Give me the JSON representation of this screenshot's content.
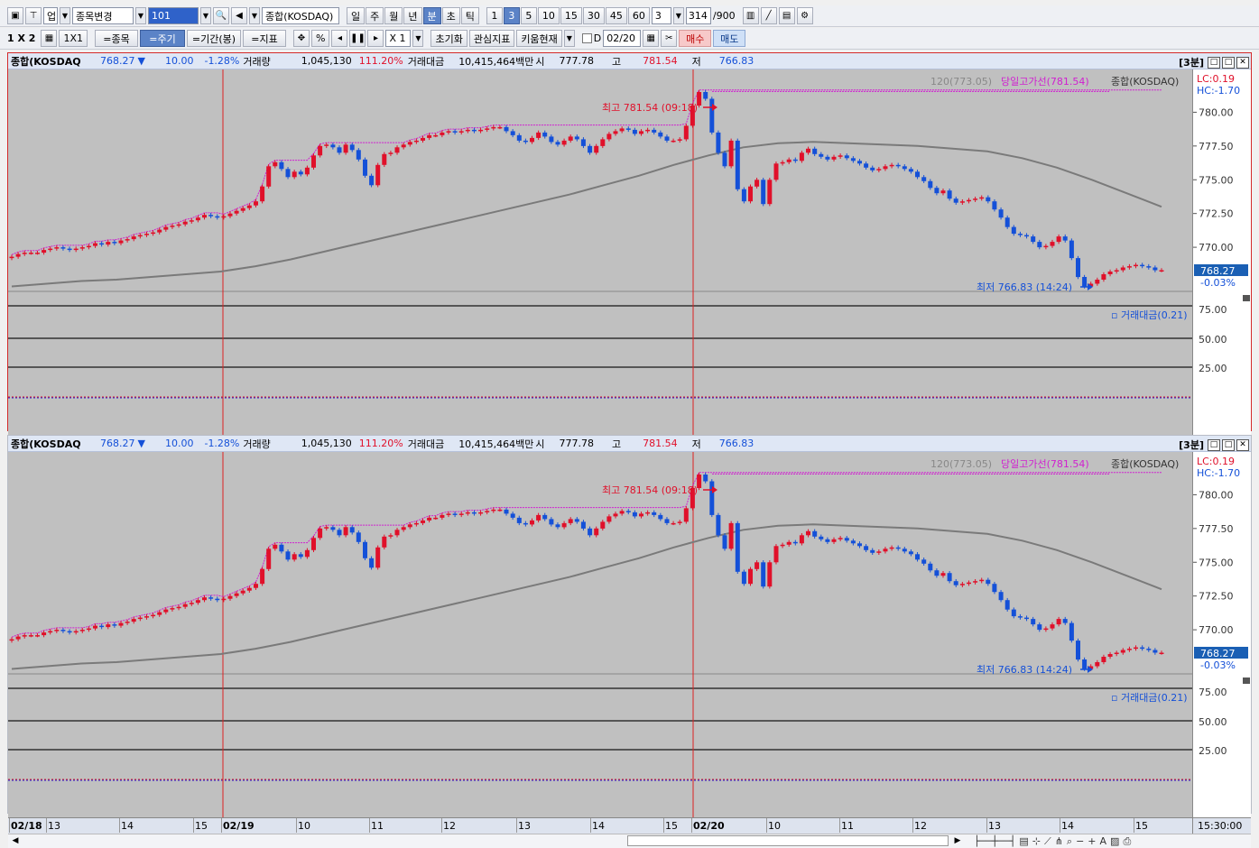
{
  "toolbar1": {
    "market": "업",
    "change_item": "종목변경",
    "code": "101",
    "name": "종합(KOSDAQ)",
    "periods": [
      "일",
      "주",
      "월",
      "년",
      "분",
      "초",
      "틱"
    ],
    "active_period": "분",
    "intervals": [
      "1",
      "3",
      "5",
      "10",
      "15",
      "30",
      "45",
      "60"
    ],
    "active_interval": "3",
    "interval_value": "3",
    "count": "314",
    "count_total": "/900"
  },
  "toolbar2": {
    "layout": "1 X 2",
    "layout_1x1": "1X1",
    "tab_item": "=종목",
    "tab_cycle": "=주기",
    "tab_period": "=기간(봉)",
    "tab_indicator": "=지표",
    "percent": "%",
    "zoom": "X 1",
    "reset": "초기화",
    "watch_indicator": "관심지표",
    "kiwoom_current": "키움현재",
    "d_label": "D",
    "date": "02/20",
    "buy": "매수",
    "sell": "매도"
  },
  "info_bar": {
    "name": "종합(KOSDAQ",
    "price": "768.27",
    "arrow": "▼",
    "change": "10.00",
    "change_pct": "-1.28%",
    "volume_label": "거래량",
    "volume": "1,045,130",
    "volume_ratio": "111.20%",
    "amount_label": "거래대금",
    "amount": "10,415,464백만",
    "open_label": "시",
    "open": "777.78",
    "high_label": "고",
    "high": "781.54",
    "low_label": "저",
    "low": "766.83",
    "interval_tag": "[3분]"
  },
  "chart_data": {
    "type": "candlestick",
    "legend": {
      "ma": "120(773.05)",
      "high_line": "당일고가선(781.54)",
      "series": "종합(KOSDAQ)"
    },
    "lc": "LC:0.19",
    "hc": "HC:-1.70",
    "current_price": "768.27",
    "current_pct": "-0.03%",
    "max_label": "최고 781.54 (09:18)",
    "min_label": "최저 766.83 (14:24)",
    "y_ticks": [
      "780.00",
      "777.50",
      "775.00",
      "772.50",
      "770.00"
    ],
    "ylim": [
      767.0,
      782.5
    ],
    "closes": [
      769.3,
      769.5,
      769.6,
      769.6,
      769.6,
      769.8,
      769.9,
      770.0,
      769.9,
      769.8,
      769.9,
      770.0,
      770.1,
      770.3,
      770.2,
      770.4,
      770.3,
      770.5,
      770.6,
      770.8,
      770.9,
      771.0,
      771.1,
      771.3,
      771.5,
      771.6,
      771.7,
      771.9,
      772.0,
      772.2,
      772.4,
      772.3,
      772.2,
      772.3,
      772.5,
      772.7,
      772.9,
      773.1,
      773.4,
      774.5,
      776.0,
      776.3,
      775.8,
      775.2,
      775.6,
      775.4,
      775.9,
      776.8,
      777.5,
      777.6,
      777.4,
      777.0,
      777.6,
      777.2,
      776.5,
      775.3,
      774.6,
      776.1,
      776.9,
      777.0,
      777.4,
      777.6,
      777.8,
      777.9,
      778.1,
      778.3,
      778.3,
      778.5,
      778.6,
      778.5,
      778.6,
      778.7,
      778.6,
      778.7,
      778.8,
      778.9,
      778.9,
      778.6,
      778.3,
      777.9,
      777.8,
      778.1,
      778.5,
      778.2,
      777.8,
      777.6,
      777.9,
      778.2,
      778.0,
      777.5,
      777.0,
      777.5,
      778.0,
      778.4,
      778.6,
      778.8,
      778.7,
      778.4,
      778.6,
      778.7,
      778.5,
      778.2,
      777.9,
      777.9,
      778.0,
      779.0,
      780.5,
      781.5,
      781.0,
      778.5,
      777.0,
      776.0,
      777.9,
      774.3,
      773.4,
      774.5,
      775.0,
      773.2,
      775.0,
      776.2,
      776.3,
      776.5,
      776.4,
      777.0,
      777.3,
      776.9,
      776.7,
      776.5,
      776.7,
      776.8,
      776.6,
      776.4,
      776.2,
      775.9,
      775.7,
      775.8,
      776.0,
      776.1,
      776.0,
      775.8,
      775.6,
      775.2,
      774.9,
      774.4,
      774.0,
      774.2,
      773.6,
      773.3,
      773.4,
      773.5,
      773.6,
      773.7,
      773.4,
      772.8,
      772.2,
      771.5,
      771.0,
      770.9,
      770.8,
      770.4,
      770.0,
      770.1,
      770.4,
      770.8,
      770.5,
      769.2,
      767.8,
      767.1,
      767.3,
      767.6,
      768.0,
      768.2,
      768.3,
      768.5,
      768.6,
      768.7,
      768.6,
      768.5,
      768.3,
      768.3
    ],
    "ma120": [
      767.1,
      767.3,
      767.5,
      767.6,
      767.8,
      768.0,
      768.2,
      768.6,
      769.1,
      769.7,
      770.3,
      770.9,
      771.5,
      772.1,
      772.7,
      773.3,
      773.9,
      774.6,
      775.3,
      776.1,
      776.8,
      777.4,
      777.7,
      777.8,
      777.7,
      777.6,
      777.5,
      777.3,
      777.1,
      776.6,
      775.9,
      775.0,
      774.0,
      773.0
    ],
    "x_labels": [
      {
        "t": "02/18",
        "bold": true
      },
      {
        "t": "13"
      },
      {
        "t": "14"
      },
      {
        "t": "15"
      },
      {
        "t": "02/19",
        "bold": true
      },
      {
        "t": "10"
      },
      {
        "t": "11"
      },
      {
        "t": "12"
      },
      {
        "t": "13"
      },
      {
        "t": "14"
      },
      {
        "t": "15"
      },
      {
        "t": "02/20",
        "bold": true
      },
      {
        "t": "10"
      },
      {
        "t": "11"
      },
      {
        "t": "12"
      },
      {
        "t": "13"
      },
      {
        "t": "14"
      },
      {
        "t": "15"
      }
    ],
    "time_label": "15:30:00"
  },
  "sub_chart": {
    "legend": "거래대금(0.21)",
    "y_ticks": [
      "75.00",
      "50.00",
      "25.00"
    ]
  },
  "colors": {
    "up": "#e0102a",
    "down": "#1450d8",
    "ma": "#7a7a7a",
    "high_line": "#d020d0",
    "plot_bg": "#c0c0c0"
  }
}
